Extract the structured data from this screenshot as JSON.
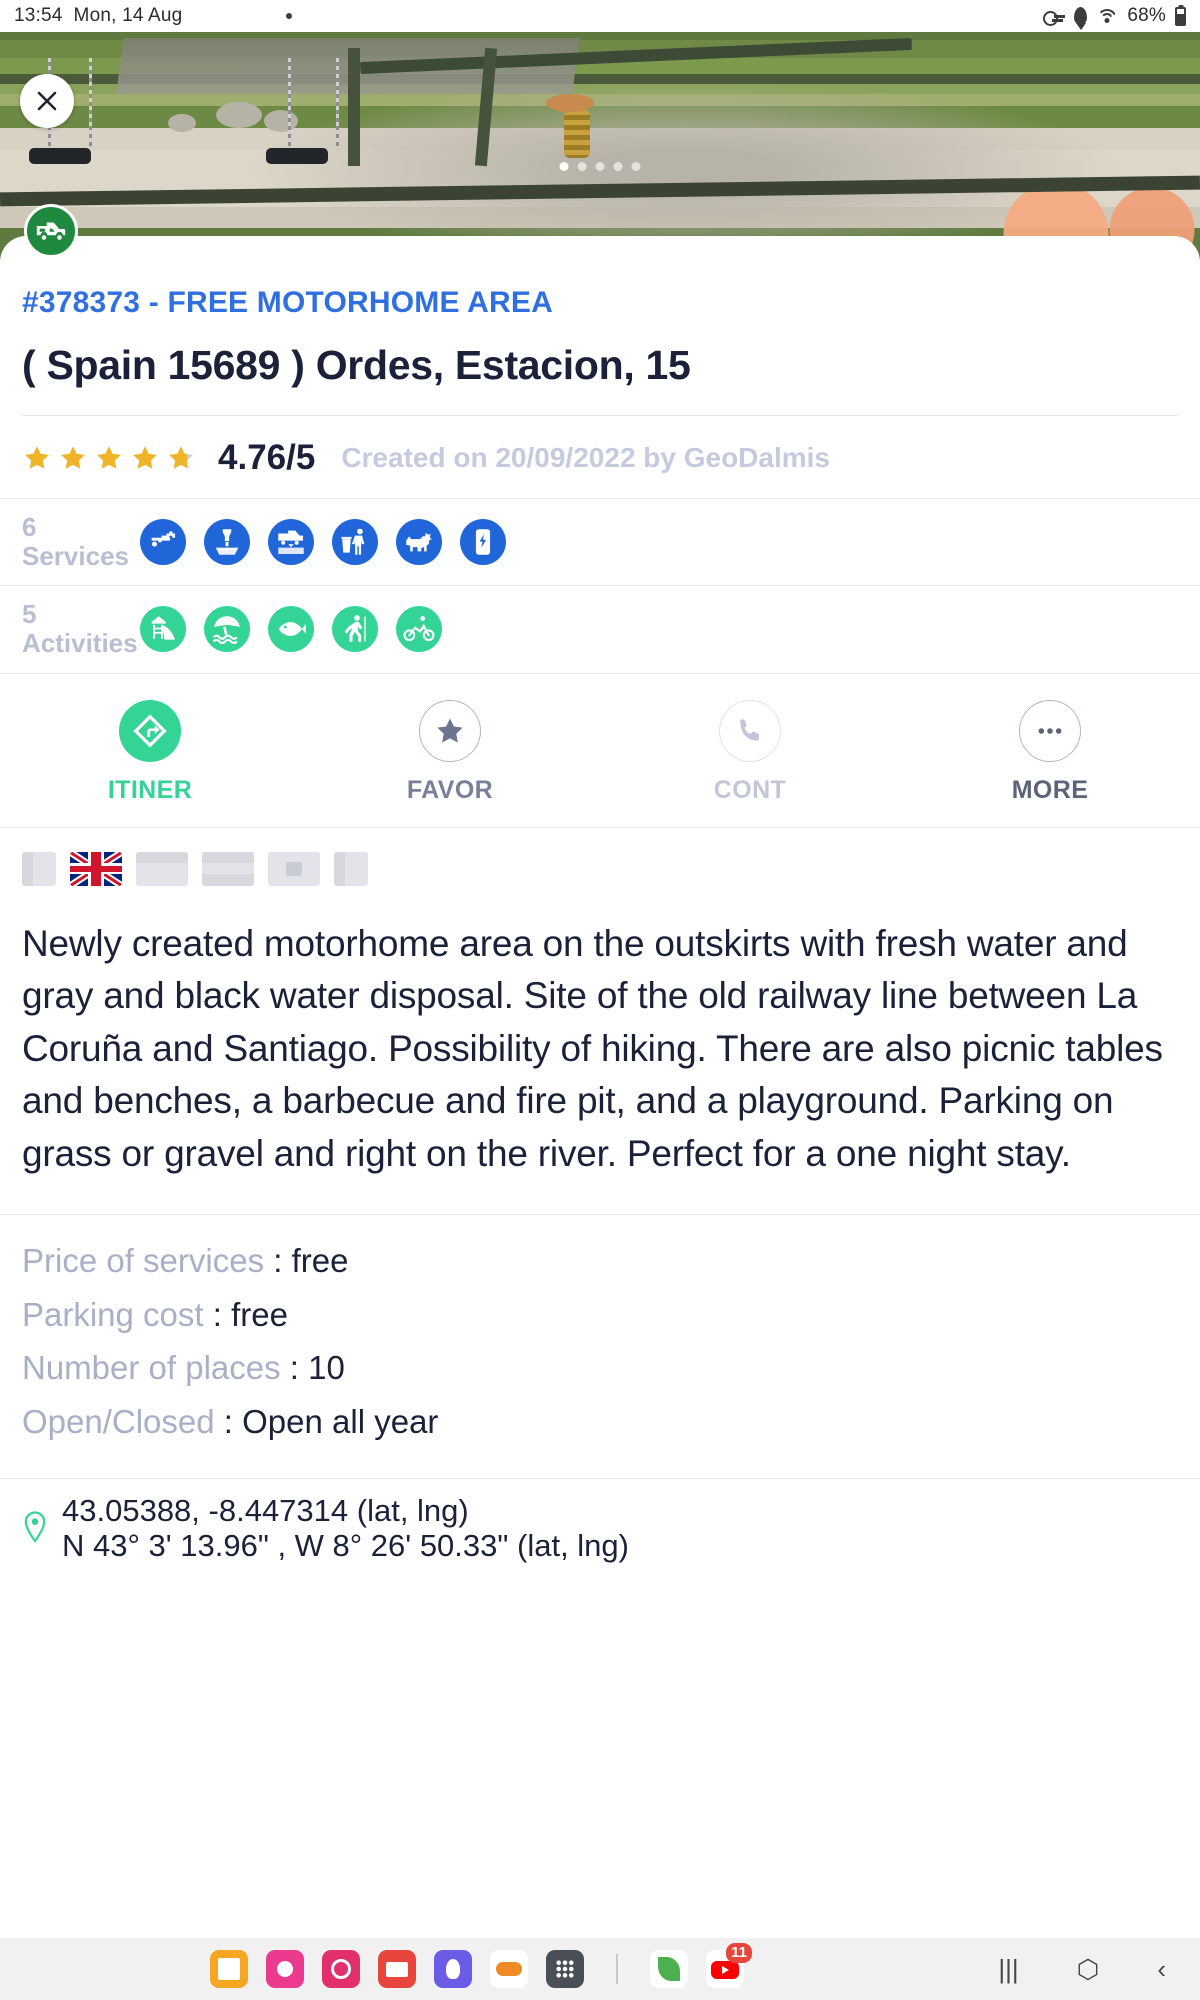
{
  "status_bar": {
    "time": "13:54",
    "date": "Mon, 14 Aug",
    "battery": "68%",
    "left_icons": [
      "photo-icon",
      "chrome-icon",
      "youtube-icon",
      "dot-icon"
    ],
    "right_icons": [
      "key-icon",
      "location-pin-icon",
      "wifi-icon",
      "battery-icon"
    ]
  },
  "photo": {
    "close_label": "×",
    "dot_count": 5,
    "active_dot": 0
  },
  "listing": {
    "category": "#378373 - FREE MOTORHOME AREA",
    "title": "( Spain 15689 ) Ordes, Estacion, 15",
    "rating_value": "4.76/5",
    "rating_number": 4.76,
    "rating_max": 5,
    "created_meta": "Created on 20/09/2022 by GeoDalmis"
  },
  "services": {
    "label": "6 Services",
    "count": 6,
    "color": "#2166d8",
    "items": [
      {
        "name": "drinking-water-tap-icon"
      },
      {
        "name": "wc-cassette-disposal-icon"
      },
      {
        "name": "grey-water-disposal-icon"
      },
      {
        "name": "trash-disposal-icon"
      },
      {
        "name": "dogs-allowed-icon"
      },
      {
        "name": "electricity-hookup-icon"
      }
    ]
  },
  "activities": {
    "label": "5 Activities",
    "count": 5,
    "color": "#34d396",
    "items": [
      {
        "name": "playground-slide-icon"
      },
      {
        "name": "beach-swimming-icon"
      },
      {
        "name": "fishing-icon"
      },
      {
        "name": "hiking-icon"
      },
      {
        "name": "cycling-icon"
      }
    ]
  },
  "actions": [
    {
      "id": "itinerary",
      "label": "ITINER",
      "icon": "directions-arrow-icon",
      "state": "primary"
    },
    {
      "id": "favorite",
      "label": "FAVOR",
      "icon": "star-icon",
      "state": "outline"
    },
    {
      "id": "contact",
      "label": "CONT",
      "icon": "phone-icon",
      "state": "disabled"
    },
    {
      "id": "more",
      "label": "MORE",
      "icon": "ellipsis-icon",
      "state": "outline"
    }
  ],
  "languages": [
    {
      "code": "xx1",
      "selected": false
    },
    {
      "code": "en",
      "selected": true
    },
    {
      "code": "xx2",
      "selected": false
    },
    {
      "code": "xx3",
      "selected": false
    },
    {
      "code": "xx4",
      "selected": false
    },
    {
      "code": "xx5",
      "selected": false
    }
  ],
  "description": "Newly created motorhome area on the outskirts with fresh water and gray and black water disposal. Site of the old railway line between La Coruña and Santiago. Possibility of hiking. There are also picnic tables and benches, a barbecue and fire pit, and a playground. Parking on grass or gravel and right on the river. Perfect for a one night stay.",
  "info": [
    {
      "key": "Price of services ",
      "value": ": free"
    },
    {
      "key": "Parking cost ",
      "value": ": free"
    },
    {
      "key": "Number of places ",
      "value": ": 10"
    },
    {
      "key": "Open/Closed ",
      "value": ": Open all year"
    }
  ],
  "coordinates": {
    "decimal": "43.05388, -8.447314 (lat, lng)",
    "dms": "N 43° 3' 13.96\" , W 8° 26' 50.33\" (lat, lng)"
  },
  "taskbar": {
    "apps": [
      {
        "name": "notes-app-icon",
        "color": "#f5a623"
      },
      {
        "name": "flower-app-icon",
        "color": "#ec3b8e"
      },
      {
        "name": "instagram-app-icon",
        "color": "#e1306c"
      },
      {
        "name": "mail-app-icon",
        "color": "#e8453c"
      },
      {
        "name": "browser-app-icon",
        "color": "#6b5ce7"
      },
      {
        "name": "weather-app-icon",
        "color": "#f08a24"
      },
      {
        "name": "apps-grid-icon",
        "color": "#4a4f57"
      },
      {
        "name": "leaf-app-icon",
        "color": "#4caf50"
      },
      {
        "name": "youtube-app-icon",
        "color": "#ff0000",
        "badge": "11"
      }
    ],
    "system": [
      {
        "name": "recents-button",
        "glyph": "|||"
      },
      {
        "name": "home-button",
        "glyph": "⬡"
      },
      {
        "name": "back-button",
        "glyph": "‹"
      }
    ]
  },
  "colors": {
    "accent_blue": "#2f6fe0",
    "service_blue": "#2166d8",
    "activity_green": "#34d396",
    "star_gold": "#f0b429",
    "text_dark": "#1b2138",
    "text_muted": "#a9afc6"
  }
}
